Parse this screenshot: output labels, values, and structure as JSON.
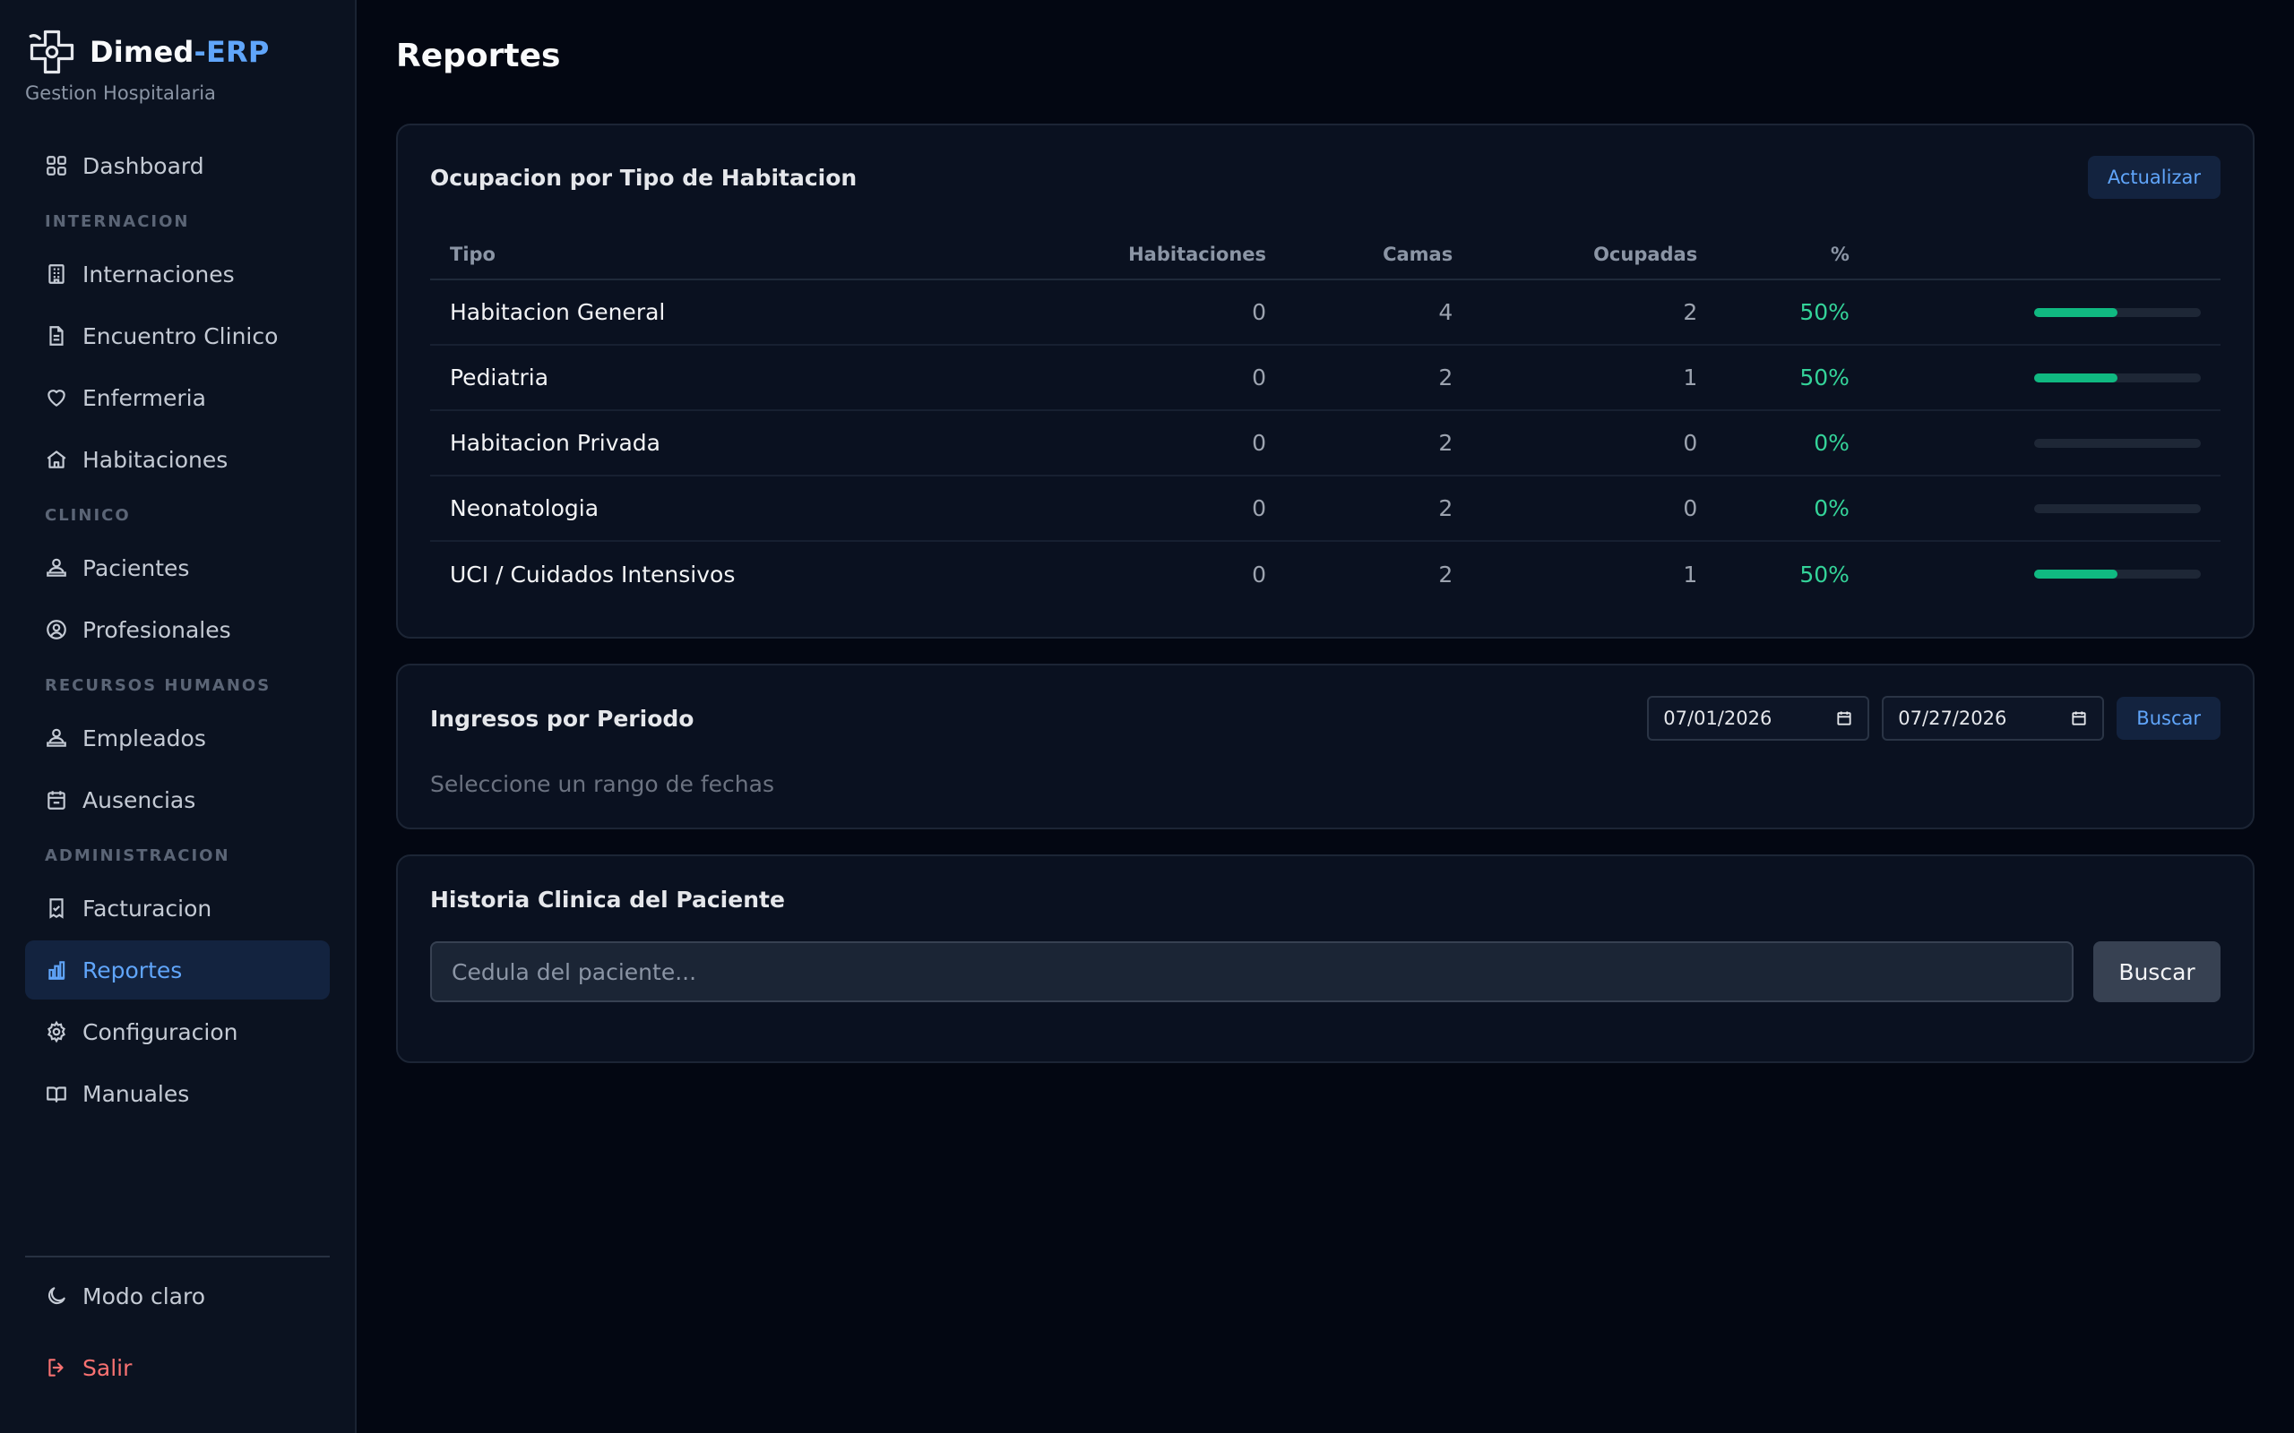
{
  "brand": {
    "name": "Dimed",
    "name_accent": "-ERP",
    "subtitle": "Gestion Hospitalaria"
  },
  "sidebar": {
    "dashboard": "Dashboard",
    "sections": {
      "internacion": "INTERNACION",
      "clinico": "CLINICO",
      "rrhh": "RECURSOS HUMANOS",
      "admin": "ADMINISTRACION"
    },
    "items": {
      "internaciones": "Internaciones",
      "encuentro": "Encuentro Clinico",
      "enfermeria": "Enfermeria",
      "habitaciones": "Habitaciones",
      "pacientes": "Pacientes",
      "profesionales": "Profesionales",
      "empleados": "Empleados",
      "ausencias": "Ausencias",
      "facturacion": "Facturacion",
      "reportes": "Reportes",
      "configuracion": "Configuracion",
      "manuales": "Manuales"
    },
    "footer": {
      "theme": "Modo claro",
      "logout": "Salir"
    }
  },
  "page": {
    "title": "Reportes"
  },
  "occupancy": {
    "title": "Ocupacion por Tipo de Habitacion",
    "refresh_label": "Actualizar",
    "columns": [
      "Tipo",
      "Habitaciones",
      "Camas",
      "Ocupadas",
      "%"
    ],
    "rows": [
      {
        "tipo": "Habitacion General",
        "habitaciones": "0",
        "camas": "4",
        "ocupadas": "2",
        "pct": "50%",
        "fill": 0.5
      },
      {
        "tipo": "Pediatria",
        "habitaciones": "0",
        "camas": "2",
        "ocupadas": "1",
        "pct": "50%",
        "fill": 0.5
      },
      {
        "tipo": "Habitacion Privada",
        "habitaciones": "0",
        "camas": "2",
        "ocupadas": "0",
        "pct": "0%",
        "fill": 0
      },
      {
        "tipo": "Neonatologia",
        "habitaciones": "0",
        "camas": "2",
        "ocupadas": "0",
        "pct": "0%",
        "fill": 0
      },
      {
        "tipo": "UCI / Cuidados Intensivos",
        "habitaciones": "0",
        "camas": "2",
        "ocupadas": "1",
        "pct": "50%",
        "fill": 0.5
      }
    ]
  },
  "admissions": {
    "title": "Ingresos por Periodo",
    "date_from": "07/01/2026",
    "date_to": "07/27/2026",
    "search_label": "Buscar",
    "hint": "Seleccione un rango de fechas"
  },
  "history": {
    "title": "Historia Clinica del Paciente",
    "placeholder": "Cedula del paciente...",
    "search_label": "Buscar"
  },
  "colors": {
    "accent": "#60a5fa",
    "success": "#10b981",
    "danger": "#f87171",
    "background": "#030712"
  }
}
